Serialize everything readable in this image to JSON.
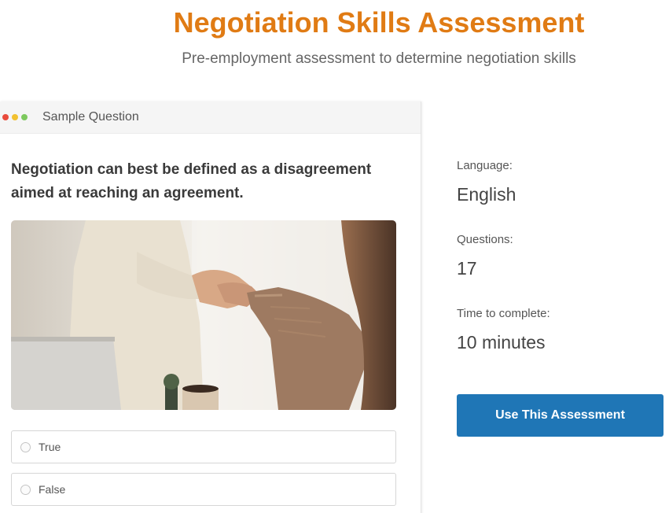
{
  "header": {
    "title": "Negotiation Skills Assessment",
    "subtitle": "Pre-employment assessment to determine negotiation skills"
  },
  "sample": {
    "header_label": "Sample Question",
    "window_dots": [
      "#e94b3c",
      "#f2c130",
      "#7dc95e"
    ],
    "question": "Negotiation can best be defined as a disagreement aimed at reaching an agreement.",
    "image_icon": "handshake-photo",
    "options": [
      {
        "label": "True"
      },
      {
        "label": "False"
      }
    ]
  },
  "info": {
    "language_label": "Language:",
    "language_value": "English",
    "questions_label": "Questions:",
    "questions_value": "17",
    "time_label": "Time to complete:",
    "time_value": "10 minutes"
  },
  "cta": {
    "label": "Use This Assessment"
  },
  "colors": {
    "accent": "#e07b14",
    "button": "#1f76b6"
  }
}
